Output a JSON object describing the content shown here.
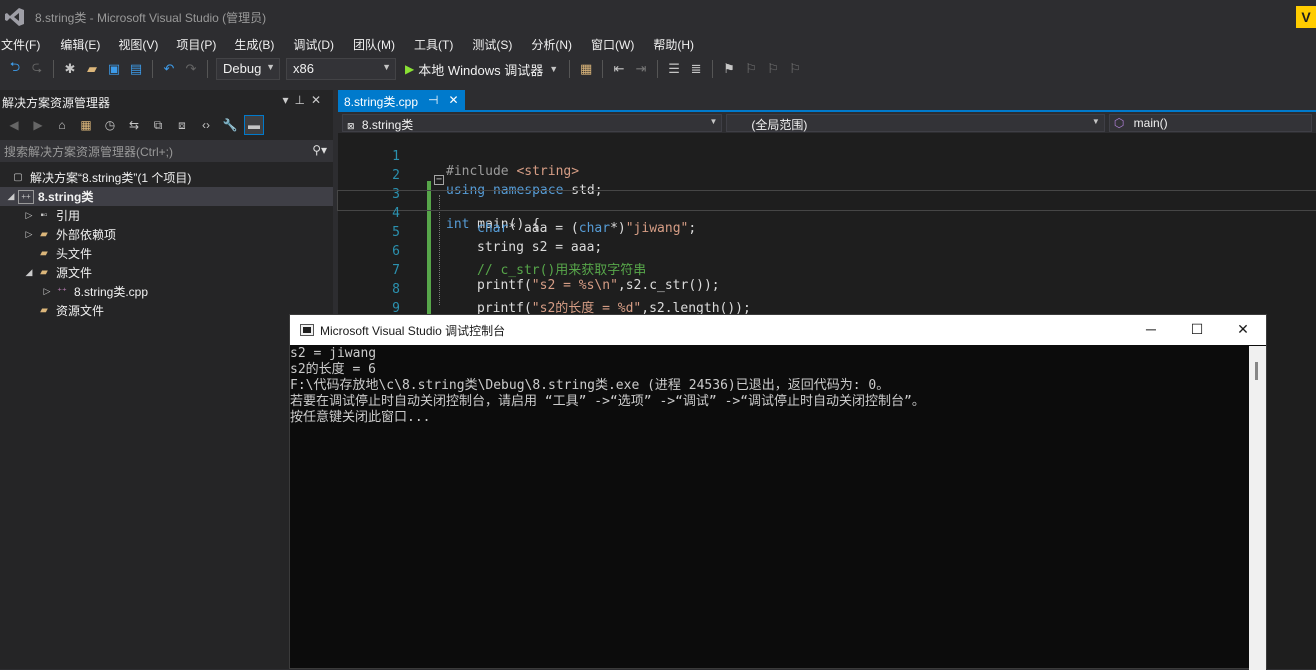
{
  "window": {
    "title": "8.string类 - Microsoft Visual Studio (管理员)",
    "badge": "V"
  },
  "menu": [
    "文件(F)",
    "编辑(E)",
    "视图(V)",
    "项目(P)",
    "生成(B)",
    "调试(D)",
    "团队(M)",
    "工具(T)",
    "测试(S)",
    "分析(N)",
    "窗口(W)",
    "帮助(H)"
  ],
  "toolbar": {
    "config": "Debug",
    "platform": "x86",
    "run_label": "本地 Windows 调试器"
  },
  "solution_explorer": {
    "title": "解决方案资源管理器",
    "search_placeholder": "搜索解决方案资源管理器(Ctrl+;)",
    "tree": {
      "solution": "解决方案“8.string类”(1 个项目)",
      "project": "8.string类",
      "references": "引用",
      "external_deps": "外部依赖项",
      "headers": "头文件",
      "sources": "源文件",
      "source_file": "8.string类.cpp",
      "resources": "资源文件"
    }
  },
  "editor": {
    "tab_label": "8.string类.cpp",
    "nav_project": "8.string类",
    "nav_scope": "(全局范围)",
    "nav_member": "main()",
    "line_numbers": [
      "1",
      "2",
      "3",
      "4",
      "5",
      "6",
      "7",
      "8",
      "9"
    ],
    "lines": {
      "l1_pre": "#include ",
      "l1_hdr": "<string>",
      "l2_kw1": "using",
      "l2_kw2": "namespace",
      "l2_rest": " std;",
      "l3_kw": "int",
      "l3_rest": " main() {",
      "l4_kw1": "char",
      "l4_mid": "* aaa = (",
      "l4_kw2": "char",
      "l4_mid2": "*)",
      "l4_str": "\"jiwang\"",
      "l4_end": ";",
      "l5": "string s2 = aaa;",
      "l6": "// c_str()用来获取字符串",
      "l7_a": "printf(",
      "l7_str": "\"s2 = %s\\n\"",
      "l7_b": ",s2.c_str());",
      "l8_a": "printf(",
      "l8_str": "\"s2的长度 = %d\"",
      "l8_b": ",s2.length());",
      "l9": "}"
    }
  },
  "console": {
    "title": "Microsoft Visual Studio 调试控制台",
    "lines": [
      "s2 = jiwang",
      "s2的长度 = 6",
      "F:\\代码存放地\\c\\8.string类\\Debug\\8.string类.exe (进程 24536)已退出，返回代码为: 0。",
      "若要在调试停止时自动关闭控制台，请启用 “工具” ->“选项” ->“调试” ->“调试停止时自动关闭控制台”。",
      "按任意键关闭此窗口..."
    ]
  }
}
